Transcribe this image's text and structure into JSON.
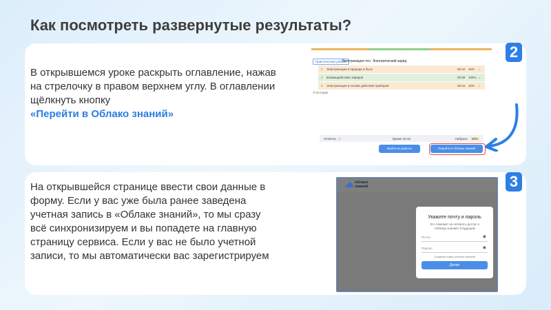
{
  "page": {
    "title": "Как посмотреть развернутые результаты?"
  },
  "step2": {
    "badge": "2",
    "text_before": "В открывшемся уроке раскрыть оглавление, нажав на стрелочку в правом верхнем углу. В оглавлении щёлкнуть кнопку",
    "link": "«Перейти в Облако знаний»"
  },
  "step3": {
    "badge": "3",
    "text": "На открывшейся странице ввести свои данные в форму. Если у вас уже была ранее заведена учетная запись в «Облаке знаний», то мы сразу всё синхронизируем и вы попадете на главную страницу сервиса. Если у вас не было учетной записи, то мы автоматически вас зарегистрируем"
  },
  "lesson": {
    "tag": "Практическая работа",
    "title": "Электризация тел. Электрический заряд",
    "toc": [
      {
        "num": "1",
        "name": "Электризация в природе и быту",
        "time": "00:42",
        "pct": "32%"
      },
      {
        "num": "2",
        "name": "Взаимодействие зарядов",
        "time": "00:30",
        "pct": "100%"
      },
      {
        "num": "3",
        "name": "Электризация в основе действия приборов",
        "time": "00:42",
        "pct": "32%"
      }
    ],
    "history": "История",
    "stats": {
      "mark_label": "Отметка",
      "mark_value": "3",
      "time_label": "Время",
      "time_value": "45:15",
      "score_label": "Набрано",
      "score_value": "59%"
    },
    "exit_button": "Выйти из работы",
    "cloud_button": "Перейти в Облако знаний"
  },
  "login": {
    "logo_line1": "облако",
    "logo_line2": "знаний",
    "title": "Укажите почту и пароль",
    "subtitle": "Это поможет не потерять доступ к «Облаку знаний» в будущем",
    "email_placeholder": "Почта",
    "password_placeholder": "Пароль",
    "recover": "Создание новых учётных записей",
    "submit": "Далее"
  },
  "colors": {
    "accent": "#2d7fe6",
    "highlight": "#e14646"
  }
}
